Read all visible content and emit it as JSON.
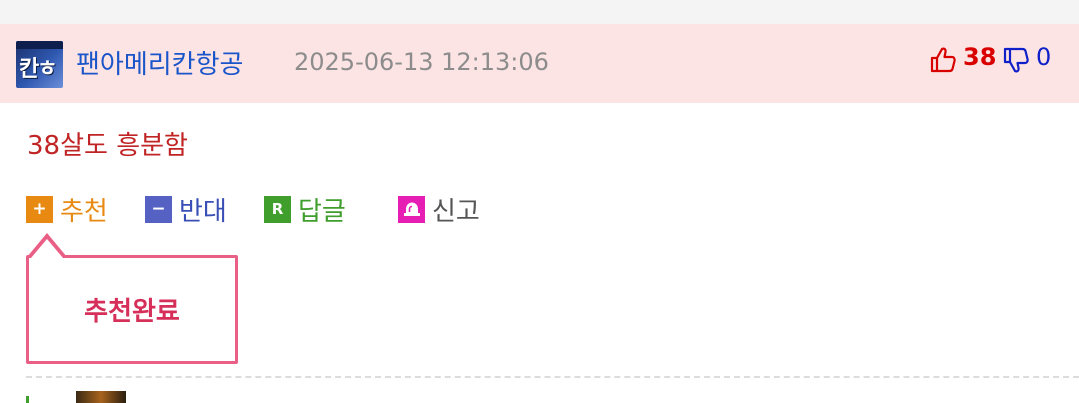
{
  "comment": {
    "author": "팬아메리칸항공",
    "avatar_text": "칸ㅎ",
    "timestamp": "2025-06-13 12:13:06",
    "votes": {
      "up_count": "38",
      "down_count": "0"
    },
    "body": "38살도 흥분함"
  },
  "actions": {
    "recommend": {
      "icon": "+",
      "label": "추천"
    },
    "oppose": {
      "icon": "−",
      "label": "반대"
    },
    "reply": {
      "icon": "R",
      "label": "답글"
    },
    "report": {
      "label": "신고"
    }
  },
  "popup": {
    "message": "추천완료"
  },
  "colors": {
    "header_bg": "#fde4e4",
    "author": "#1a55c9",
    "upvote": "#d90000",
    "downvote": "#1020c8",
    "comment_text": "#c02424",
    "recommend": "#e88a12",
    "oppose": "#5562c4",
    "reply": "#3f9e2c",
    "report": "#e61eb4",
    "popup_border": "#ea5f86"
  }
}
